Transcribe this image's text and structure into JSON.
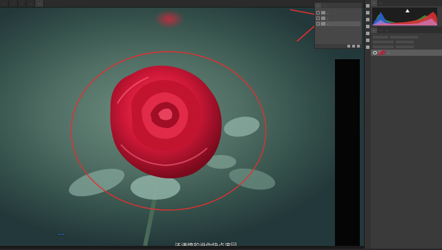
{
  "document_tabs": [
    {
      "label": "...",
      "active": false
    },
    {
      "label": "...",
      "active": false
    },
    {
      "label": "...",
      "active": false
    },
    {
      "label": "...",
      "active": false
    },
    {
      "label": "...",
      "active": true
    }
  ],
  "layer_comps_panel": {
    "tabs": [
      "...",
      "..."
    ],
    "items": [
      {
        "label": "..."
      },
      {
        "label": "..."
      },
      {
        "label": "..."
      }
    ]
  },
  "histogram_panel": {
    "tabs": [
      "...",
      "..."
    ]
  },
  "layers_panel": {
    "tabs": [
      "...",
      "...",
      "..."
    ],
    "layer_name": "..."
  },
  "overlays": {
    "watermark": "...",
    "subtitle": "还谨慎的说你快点滚回"
  },
  "colors": {
    "accent_red": "#e2302f",
    "watermark_blue": "#2f7bd8"
  }
}
